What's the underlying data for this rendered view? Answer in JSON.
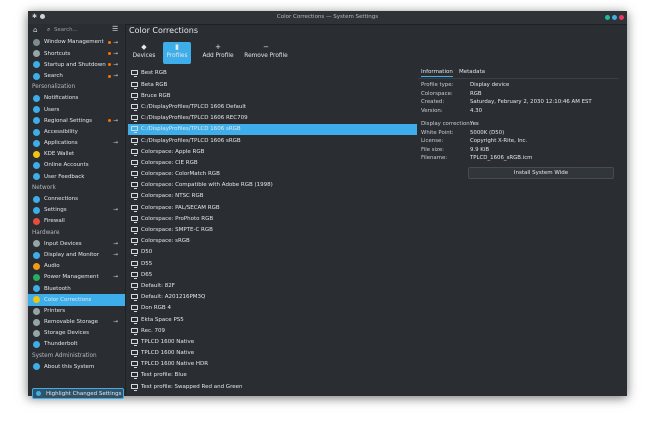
{
  "window": {
    "title": "Color Corrections — System Settings",
    "buttons": [
      {
        "name": "minimize",
        "color": "#1abc9c"
      },
      {
        "name": "maximize",
        "color": "#3daee9"
      },
      {
        "name": "close",
        "color": "#e93a66"
      }
    ]
  },
  "sidebar": {
    "search_placeholder": "Search...",
    "rows": [
      {
        "type": "item",
        "label": "Window Management",
        "icon_color": "#7f8c8d",
        "dot": true,
        "arrow": true
      },
      {
        "type": "item",
        "label": "Shortcuts",
        "icon_color": "#95a5a6",
        "dot": true,
        "arrow": true
      },
      {
        "type": "item",
        "label": "Startup and Shutdown",
        "icon_color": "#3daee9",
        "dot": true,
        "arrow": true
      },
      {
        "type": "item",
        "label": "Search",
        "icon_color": "#3daee9",
        "dot": true,
        "arrow": true
      },
      {
        "type": "category",
        "label": "Personalization"
      },
      {
        "type": "item",
        "label": "Notifications",
        "icon_color": "#3daee9"
      },
      {
        "type": "item",
        "label": "Users",
        "icon_color": "#3daee9"
      },
      {
        "type": "item",
        "label": "Regional Settings",
        "icon_color": "#3daee9",
        "dot": true,
        "arrow": true
      },
      {
        "type": "item",
        "label": "Accessibility",
        "icon_color": "#3daee9"
      },
      {
        "type": "item",
        "label": "Applications",
        "icon_color": "#3daee9",
        "arrow": true
      },
      {
        "type": "item",
        "label": "KDE Wallet",
        "icon_color": "#f1c40f"
      },
      {
        "type": "item",
        "label": "Online Accounts",
        "icon_color": "#3daee9"
      },
      {
        "type": "item",
        "label": "User Feedback",
        "icon_color": "#3daee9"
      },
      {
        "type": "category",
        "label": "Network"
      },
      {
        "type": "item",
        "label": "Connections",
        "icon_color": "#3daee9"
      },
      {
        "type": "item",
        "label": "Settings",
        "icon_color": "#3daee9",
        "arrow": true
      },
      {
        "type": "item",
        "label": "Firewall",
        "icon_color": "#e74c3c"
      },
      {
        "type": "category",
        "label": "Hardware"
      },
      {
        "type": "item",
        "label": "Input Devices",
        "icon_color": "#95a5a6",
        "arrow": true
      },
      {
        "type": "item",
        "label": "Display and Monitor",
        "icon_color": "#3daee9",
        "arrow": true
      },
      {
        "type": "item",
        "label": "Audio",
        "icon_color": "#f39c12"
      },
      {
        "type": "item",
        "label": "Power Management",
        "icon_color": "#27ae60",
        "arrow": true
      },
      {
        "type": "item",
        "label": "Bluetooth",
        "icon_color": "#3daee9"
      },
      {
        "type": "item",
        "label": "Color Corrections",
        "icon_color": "#f1c40f",
        "selected": true
      },
      {
        "type": "item",
        "label": "Printers",
        "icon_color": "#95a5a6"
      },
      {
        "type": "item",
        "label": "Removable Storage",
        "icon_color": "#95a5a6",
        "arrow": true
      },
      {
        "type": "item",
        "label": "Storage Devices",
        "icon_color": "#95a5a6"
      },
      {
        "type": "item",
        "label": "Thunderbolt",
        "icon_color": "#3daee9"
      },
      {
        "type": "category",
        "label": "System Administration"
      },
      {
        "type": "item",
        "label": "About this System",
        "icon_color": "#3daee9"
      }
    ],
    "highlight_button": "Highlight Changed Settings"
  },
  "main": {
    "title": "Color Corrections",
    "toolbar": [
      {
        "label": "Devices",
        "icon": "◆",
        "icon_name": "devices-icon"
      },
      {
        "label": "Profiles",
        "icon": "▮",
        "icon_name": "profiles-icon",
        "active": true
      },
      {
        "label": "Add Profile",
        "icon": "+",
        "icon_name": "add-icon"
      },
      {
        "label": "Remove Profile",
        "icon": "−",
        "icon_name": "remove-icon"
      }
    ],
    "profiles": [
      "Best RGB",
      "Beta RGB",
      "Bruce RGB",
      "C:/DisplayProfiles/TPLCD 1606 Default",
      "C:/DisplayProfiles/TPLCD 1606 REC709",
      "C:/DisplayProfiles/TPLCD 1606 sRGB",
      "C:/DisplayProfiles/TPLCD 1606 sRGB",
      "Colorspace: Apple RGB",
      "Colorspace: CIE RGB",
      "Colorspace: ColorMatch RGB",
      "Colorspace: Compatible with Adobe RGB (1998)",
      "Colorspace: NTSC RGB",
      "Colorspace: PAL/SECAM RGB",
      "Colorspace: ProPhoto RGB",
      "Colorspace: SMPTE-C RGB",
      "Colorspace: sRGB",
      "D50",
      "D55",
      "D65",
      "Default: 82F",
      "Default: A201216PM3Q",
      "Don RGB 4",
      "Ekta Space PS5",
      "Rec. 709",
      "TPLCD 1600 Native",
      "TPLCD 1600 Native",
      "TPLCD 1600 Native HDR",
      "Test profile: Blue",
      "Test profile: Swapped Red and Green"
    ],
    "selected_profile_index": 5,
    "details": {
      "tabs": [
        "Information",
        "Metadata"
      ],
      "rows_group1": [
        {
          "k": "Profile type:",
          "v": "Display device"
        },
        {
          "k": "Colorspace:",
          "v": "RGB"
        },
        {
          "k": "Created:",
          "v": "Saturday, February 2, 2030 12:10:46 AM EST"
        },
        {
          "k": "Version:",
          "v": "4.30"
        }
      ],
      "rows_group2": [
        {
          "k": "Display correction:",
          "v": "Yes"
        },
        {
          "k": "White Point:",
          "v": "5000K (D50)"
        },
        {
          "k": "License:",
          "v": "Copyright X-Rite, Inc."
        },
        {
          "k": "File size:",
          "v": "9.9 KiB"
        },
        {
          "k": "Filename:",
          "v": "TPLCD_1606_sRGB.icm"
        }
      ],
      "install_button": "Install System Wide"
    }
  }
}
